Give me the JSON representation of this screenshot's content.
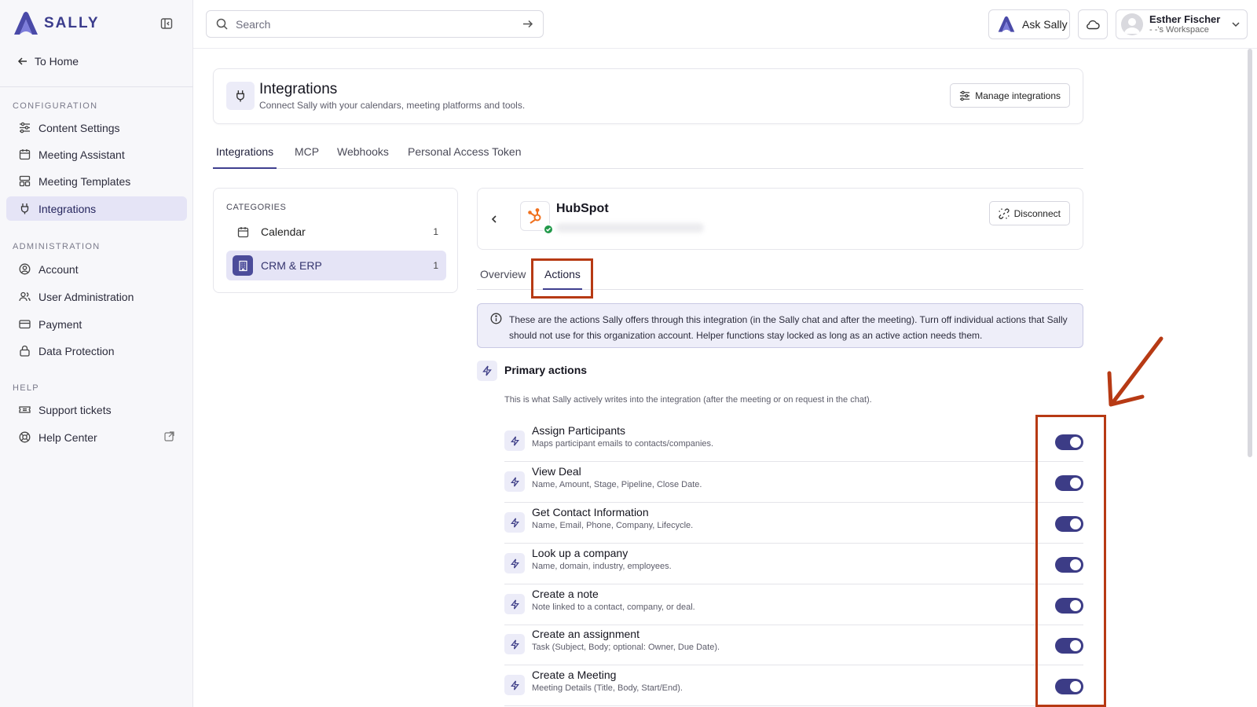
{
  "brand": {
    "name": "SALLY"
  },
  "sidebar": {
    "to_home": "To Home",
    "sections": {
      "configuration": "CONFIGURATION",
      "administration": "ADMINISTRATION",
      "help": "HELP"
    },
    "items": [
      {
        "label": "Content Settings",
        "icon": "sliders-icon"
      },
      {
        "label": "Meeting Assistant",
        "icon": "calendar-icon"
      },
      {
        "label": "Meeting Templates",
        "icon": "templates-icon"
      },
      {
        "label": "Integrations",
        "icon": "plug-icon",
        "active": true
      },
      {
        "label": "Account",
        "icon": "user-circle-icon"
      },
      {
        "label": "User Administration",
        "icon": "users-icon"
      },
      {
        "label": "Payment",
        "icon": "credit-card-icon"
      },
      {
        "label": "Data Protection",
        "icon": "lock-icon"
      },
      {
        "label": "Support tickets",
        "icon": "ticket-icon"
      },
      {
        "label": "Help Center",
        "icon": "lifebuoy-icon"
      }
    ]
  },
  "topbar": {
    "search_placeholder": "Search",
    "ask_label": "Ask Sally",
    "user": {
      "name": "Esther Fischer",
      "workspace": "- -'s Workspace"
    }
  },
  "header": {
    "title": "Integrations",
    "subtitle": "Connect Sally with your calendars, meeting platforms and tools.",
    "manage_label": "Manage integrations"
  },
  "tabs": [
    "Integrations",
    "MCP",
    "Webhooks",
    "Personal Access Token"
  ],
  "categories": {
    "label": "CATEGORIES",
    "items": [
      {
        "label": "Calendar",
        "count": "1"
      },
      {
        "label": "CRM & ERP",
        "count": "1",
        "active": true
      }
    ]
  },
  "integration": {
    "name": "HubSpot",
    "disconnect_label": "Disconnect",
    "subtabs": [
      "Overview",
      "Actions"
    ],
    "active_subtab": "Actions",
    "info": "These are the actions Sally offers through this integration (in the Sally chat and after the meeting). Turn off individual actions that Sally should not use for this organization account. Helper functions stay locked as long as an active action needs them.",
    "primary_title": "Primary actions",
    "primary_desc": "This is what Sally actively writes into the integration (after the meeting or on request in the chat).",
    "actions": [
      {
        "title": "Assign Participants",
        "desc": "Maps participant emails to contacts/companies.",
        "enabled": true
      },
      {
        "title": "View Deal",
        "desc": "Name, Amount, Stage, Pipeline, Close Date.",
        "enabled": true
      },
      {
        "title": "Get Contact Information",
        "desc": "Name, Email, Phone, Company, Lifecycle.",
        "enabled": true
      },
      {
        "title": "Look up a company",
        "desc": "Name, domain, industry, employees.",
        "enabled": true
      },
      {
        "title": "Create a note",
        "desc": "Note linked to a contact, company, or deal.",
        "enabled": true
      },
      {
        "title": "Create an assignment",
        "desc": "Task (Subject, Body; optional: Owner, Due Date).",
        "enabled": true
      },
      {
        "title": "Create a Meeting",
        "desc": "Meeting Details (Title, Body, Start/End).",
        "enabled": true
      }
    ]
  },
  "colors": {
    "accent": "#3c3c86",
    "annotation": "#b73a14"
  }
}
